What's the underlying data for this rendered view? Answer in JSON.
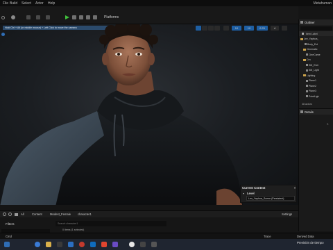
{
  "menu": {
    "items": [
      "File",
      "Build",
      "Select",
      "Actor",
      "Help"
    ],
    "title": "Metahuman"
  },
  "toolbar": {
    "platforms_label": "Platforms"
  },
  "viewport": {
    "tooltip": "Hold Ctrl + Alt (or middle mouse) + Left Click to move the camera",
    "buttons": [
      "10",
      "10",
      "0.25",
      "4"
    ]
  },
  "current_context": {
    "title": "Current Context",
    "level_label": "Level",
    "level_value": "Lev_Yaphoa_Scene (Persistent)"
  },
  "outliner": {
    "title": "Outliner",
    "column": "Item Label",
    "rows": [
      {
        "label": "Lev_Yaphoa_",
        "kind": "folder",
        "indent": 0
      },
      {
        "label": "Body_Ext",
        "kind": "actor",
        "indent": 3
      },
      {
        "label": "Cinematic",
        "kind": "folder",
        "indent": 2
      },
      {
        "label": "CineCame",
        "kind": "actor",
        "indent": 4
      },
      {
        "label": "Crn",
        "kind": "folder",
        "indent": 2
      },
      {
        "label": "SM_Ever",
        "kind": "actor",
        "indent": 4
      },
      {
        "label": "SM_Light",
        "kind": "actor",
        "indent": 4
      },
      {
        "label": "Lighting",
        "kind": "folder",
        "indent": 2
      },
      {
        "label": "Plane1",
        "kind": "actor",
        "indent": 4
      },
      {
        "label": "Plane2",
        "kind": "actor",
        "indent": 4
      },
      {
        "label": "Plane3",
        "kind": "actor",
        "indent": 4
      },
      {
        "label": "PointLigh",
        "kind": "actor",
        "indent": 4
      }
    ],
    "count": "38 actors"
  },
  "details": {
    "title": "Details",
    "hint": "S"
  },
  "content_browser": {
    "breadcrumbs": [
      "All",
      "Content",
      "Modest_Female",
      "character1"
    ],
    "settings_label": "Settings",
    "filters_label": "Filters",
    "search_placeholder": "Search character1",
    "item_count": "0 items (1 selected)"
  },
  "statusbar": {
    "left": "Cmd",
    "trace": "Trace",
    "derived": "Derived Data",
    "source": "Source Control Off",
    "revision": "Revision Control"
  },
  "taskbar": {
    "clock": "Previsión de tiempo"
  }
}
